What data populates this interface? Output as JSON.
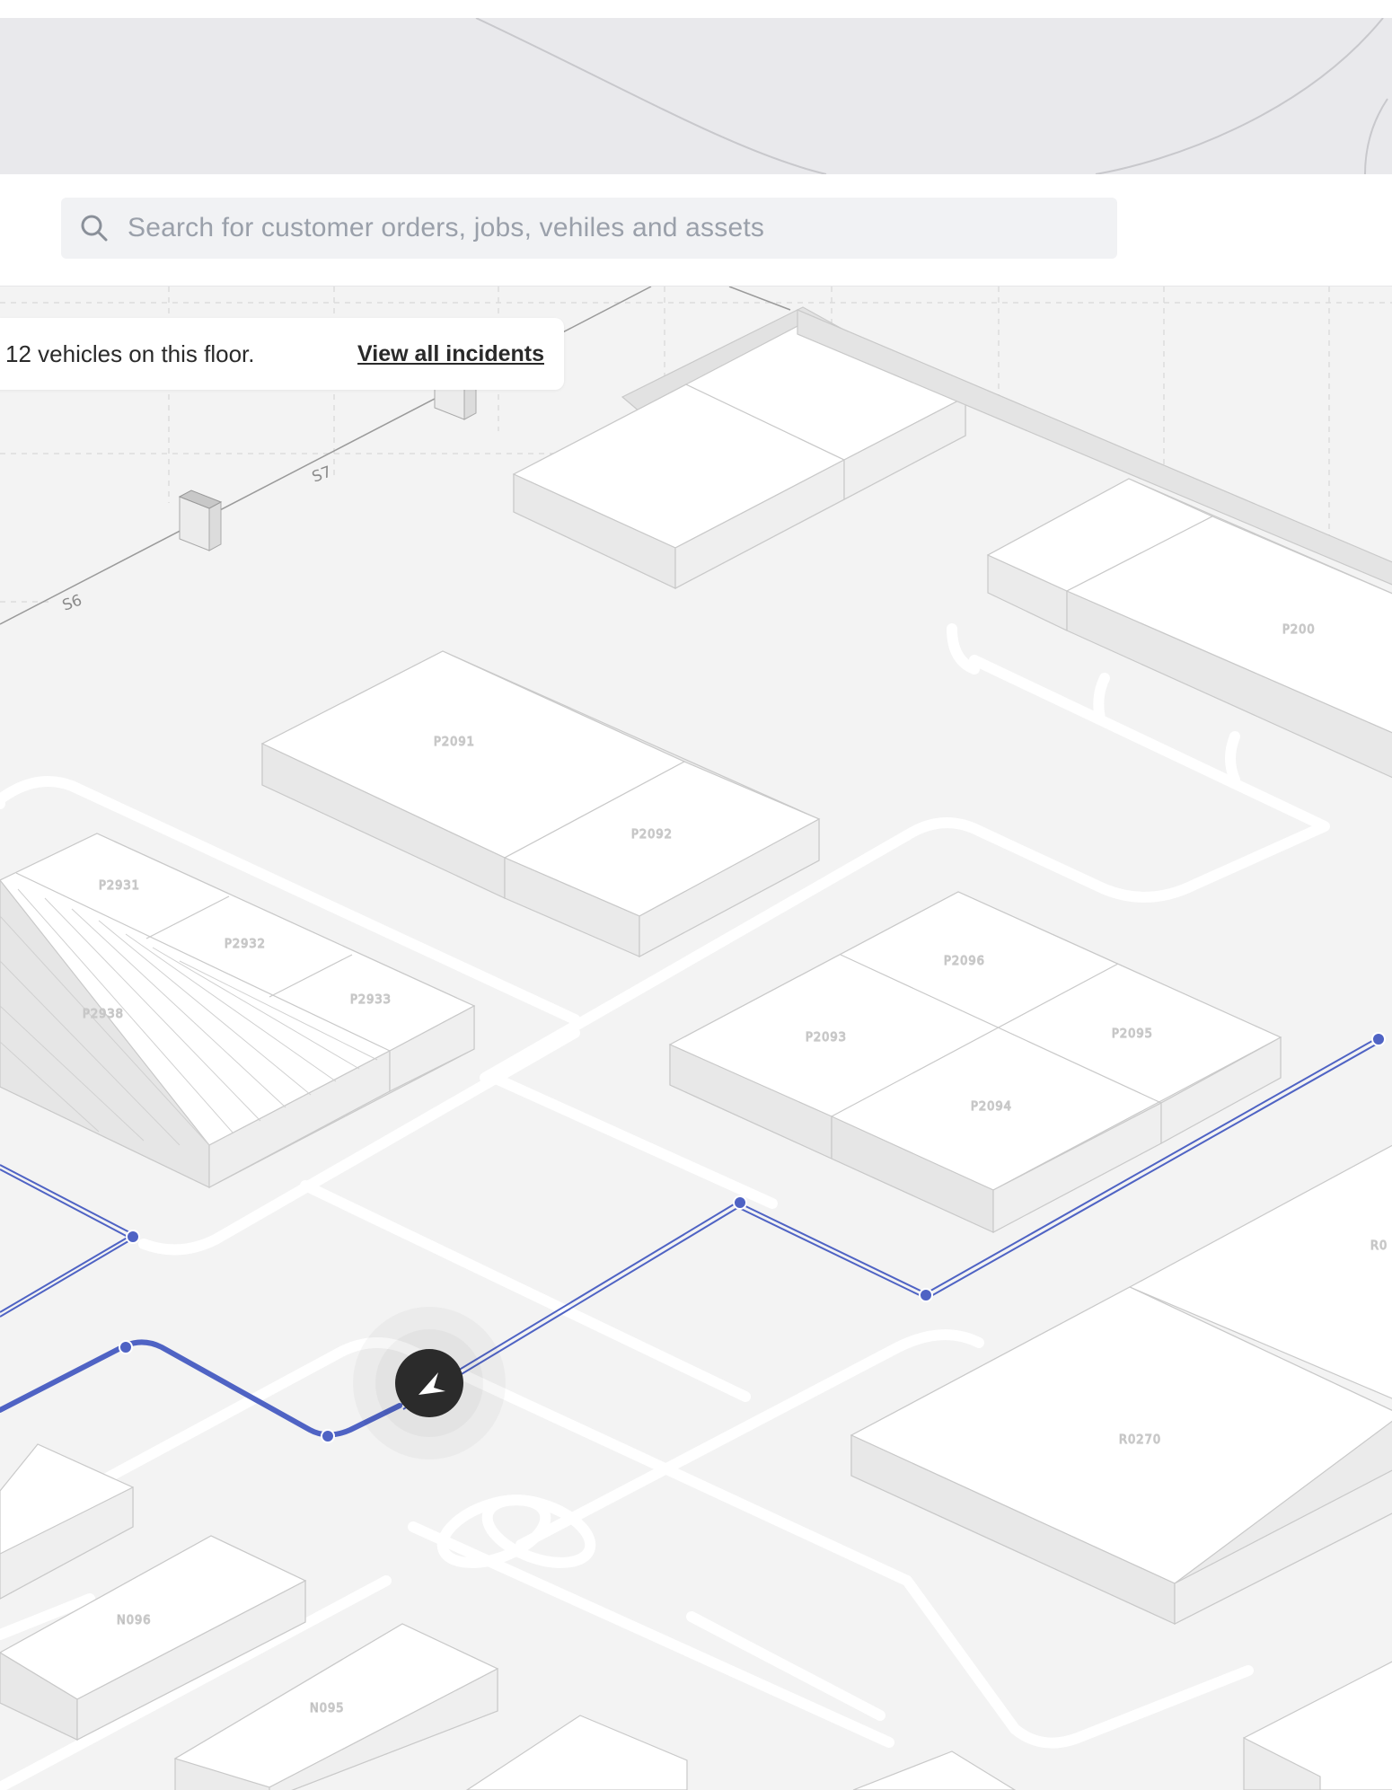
{
  "search": {
    "placeholder": "Search for customer orders, jobs, vehiles and assets",
    "icon": "search-icon"
  },
  "info_card": {
    "text": "12 vehicles on this floor.",
    "link": "View all incidents"
  },
  "map": {
    "route_color": "#4f63c4",
    "vehicle_marker_color": "#2b2b2b",
    "shelf_labels": [
      "S6",
      "S7"
    ],
    "zones": [
      {
        "label": "P200"
      },
      {
        "label": "P2091"
      },
      {
        "label": "P2092"
      },
      {
        "label": "P2931"
      },
      {
        "label": "P2932"
      },
      {
        "label": "P2933"
      },
      {
        "label": "P2938"
      },
      {
        "label": "P2096"
      },
      {
        "label": "P2093"
      },
      {
        "label": "P2095"
      },
      {
        "label": "P2094"
      },
      {
        "label": "R0270"
      },
      {
        "label": "R0"
      },
      {
        "label": "N096"
      },
      {
        "label": "N095"
      }
    ]
  }
}
